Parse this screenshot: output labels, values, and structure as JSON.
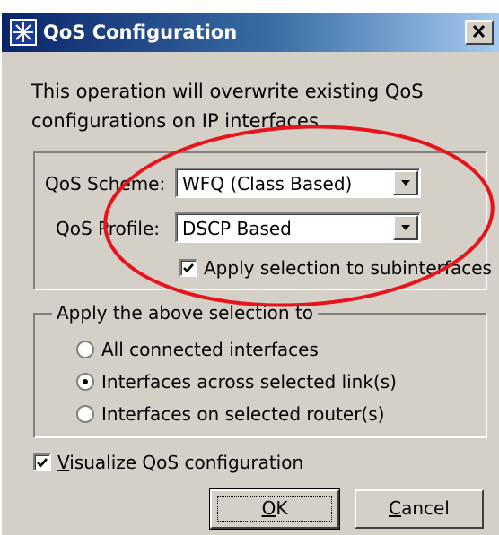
{
  "window": {
    "title": "QoS Configuration",
    "close_glyph": "✕"
  },
  "message": {
    "line1": "This operation will overwrite existing QoS",
    "line2": "configurations on IP interfaces."
  },
  "qos_group": {
    "scheme_label": "QoS Scheme:",
    "scheme_value": "WFQ (Class Based)",
    "profile_label": "QoS Profile:",
    "profile_value": "DSCP Based",
    "apply_sub_label": "Apply selection to subinterfaces",
    "apply_sub_checked": true
  },
  "apply_group": {
    "legend": "Apply the above selection to",
    "options": [
      {
        "label": "All connected interfaces",
        "selected": false
      },
      {
        "label": "Interfaces across selected link(s)",
        "selected": true
      },
      {
        "label": "Interfaces on selected router(s)",
        "selected": false
      }
    ]
  },
  "visualize": {
    "mnemonic": "V",
    "rest": "isualize QoS configuration",
    "checked": true
  },
  "buttons": {
    "ok_mnemonic": "O",
    "ok_rest": "K",
    "cancel_mnemonic": "C",
    "cancel_rest": "ancel"
  },
  "annotation": {
    "shape": "ellipse",
    "color": "#e8141c"
  },
  "icons": {
    "app": "star-burst-icon",
    "close": "close-icon",
    "dropdown": "chevron-down-icon",
    "check": "check-icon"
  }
}
